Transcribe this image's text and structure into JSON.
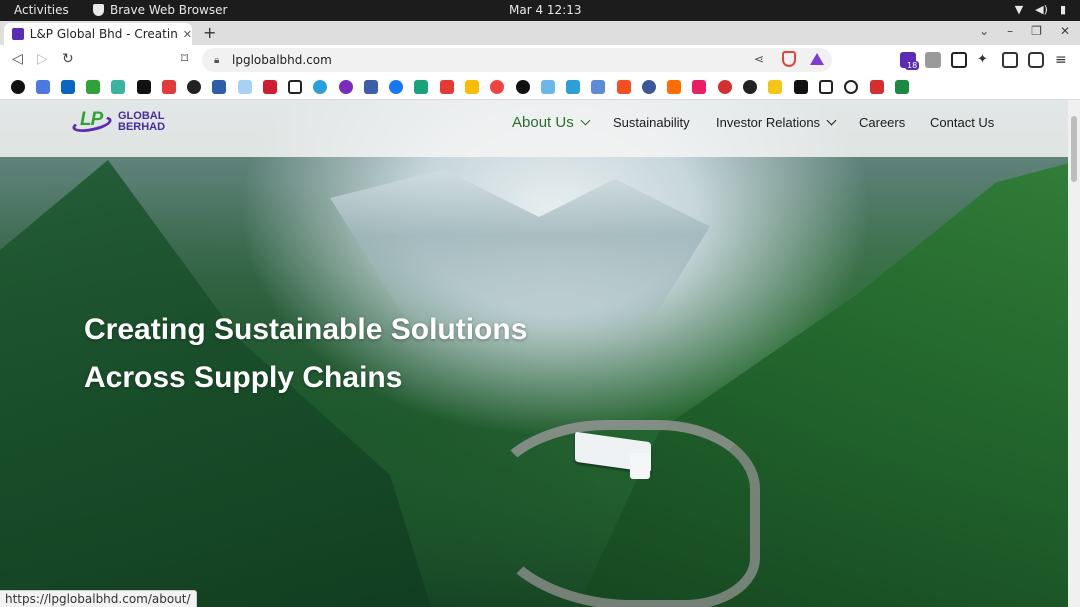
{
  "system": {
    "activities": "Activities",
    "app_name": "Brave Web Browser",
    "clock": "Mar 4  12:13"
  },
  "browser": {
    "tab_title": "L&P Global Bhd - Creating",
    "new_tab": "+",
    "url": "lpglobalbhd.com",
    "extension_badge": "18",
    "status_url": "https://lpglobalbhd.com/about/"
  },
  "site": {
    "logo": {
      "mark": "LP",
      "line1": "GLOBAL",
      "line2": "BERHAD"
    },
    "nav": [
      {
        "label": "About Us",
        "has_dropdown": true,
        "active": true
      },
      {
        "label": "Sustainability",
        "has_dropdown": false,
        "active": false
      },
      {
        "label": "Investor Relations",
        "has_dropdown": true,
        "active": false
      },
      {
        "label": "Careers",
        "has_dropdown": false,
        "active": false
      },
      {
        "label": "Contact Us",
        "has_dropdown": false,
        "active": false
      }
    ],
    "hero": {
      "line1": "Creating Sustainable Solutions",
      "line2": "Across Supply Chains"
    }
  },
  "colors": {
    "brand_purple": "#5a2bb5",
    "brand_green": "#2fa33a",
    "active_nav": "#2c6e2e"
  }
}
